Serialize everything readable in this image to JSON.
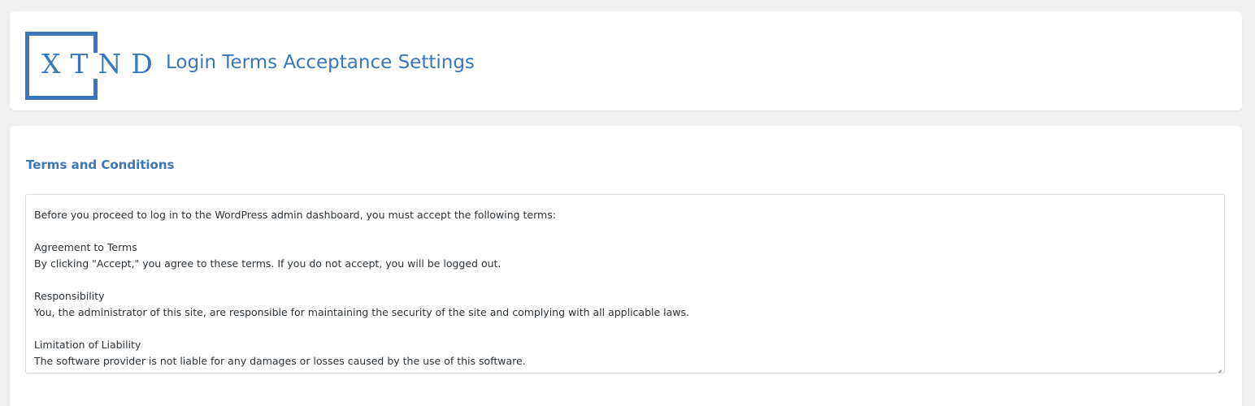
{
  "header": {
    "logo_text": "XTND",
    "title": "Login Terms Acceptance Settings"
  },
  "section": {
    "title": "Terms and Conditions"
  },
  "terms": {
    "intro": "Before you proceed to log in to the WordPress admin dashboard, you must accept the following terms:",
    "items": [
      {
        "heading": "Agreement to Terms",
        "body": "By clicking \"Accept,\" you agree to these terms. If you do not accept, you will be logged out."
      },
      {
        "heading": "Responsibility",
        "body": "You, the administrator of this site, are responsible for maintaining the security of the site and complying with all applicable laws."
      },
      {
        "heading": "Limitation of Liability",
        "body": "The software provider is not liable for any damages or losses caused by the use of this software."
      }
    ]
  },
  "colors": {
    "accent": "#3b75ba",
    "background": "#f0f0f1",
    "text": "#2c3338"
  }
}
